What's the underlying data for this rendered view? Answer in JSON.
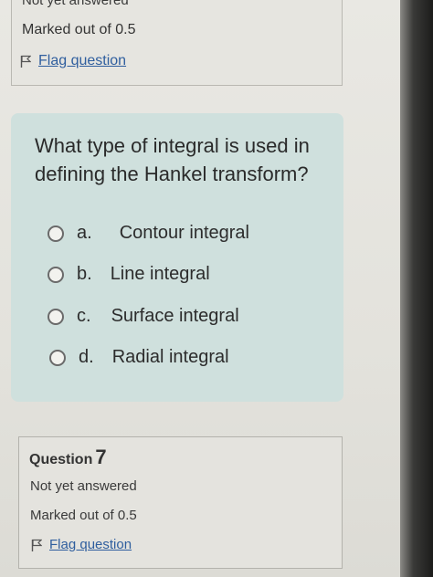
{
  "previous_question": {
    "status": "Not yet answered",
    "marks": "Marked out of 0.5",
    "flag_label": "Flag question"
  },
  "question": {
    "text": "What type of integral is used in defining the Hankel transform?",
    "options": [
      {
        "letter": "a.",
        "text": "Contour integral"
      },
      {
        "letter": "b.",
        "text": "Line integral"
      },
      {
        "letter": "c.",
        "text": "Surface integral"
      },
      {
        "letter": "d.",
        "text": "Radial integral"
      }
    ]
  },
  "next_question": {
    "label": "Question",
    "number": "7",
    "status": "Not yet answered",
    "marks": "Marked out of 0.5",
    "flag_label": "Flag question"
  },
  "colors": {
    "link": "#2f5e9e",
    "question_box": "#cfe0dd"
  },
  "icons": [
    "flag-icon",
    "radio-button-icon"
  ]
}
